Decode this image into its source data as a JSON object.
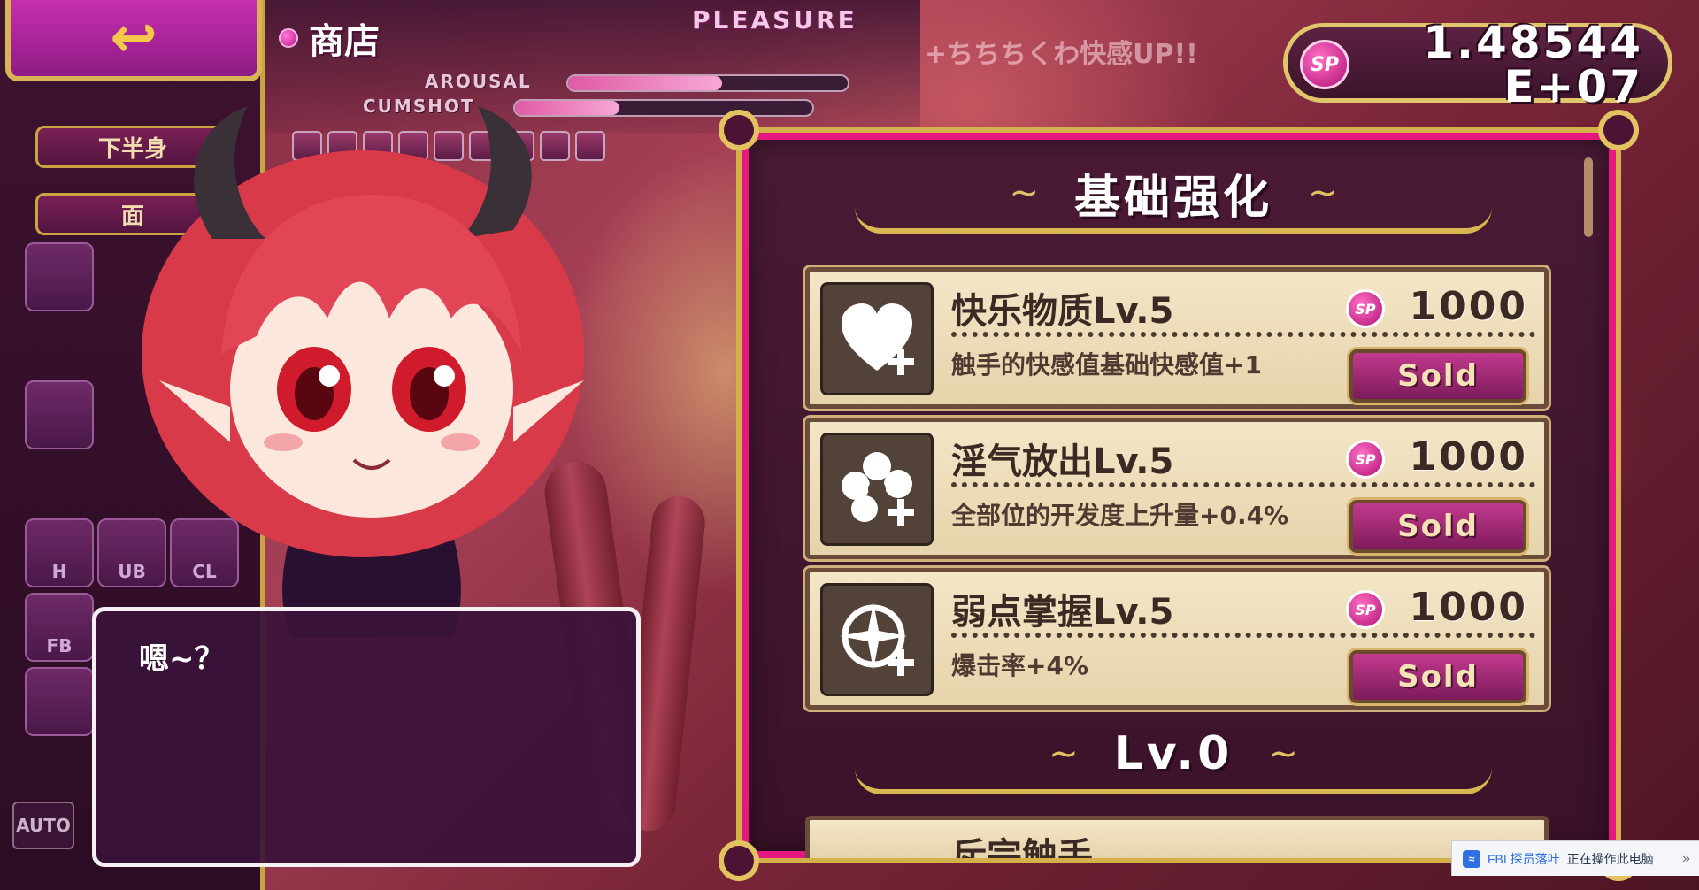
{
  "top_bar": {
    "shop_title": "商店",
    "pleasure_label": "PLEASURE",
    "arousal_label": "AROUSAL",
    "cumshot_label": "CUMSHOT",
    "arousal_level": 0.55,
    "cumshot_level": 0.35,
    "faint_info": "+ちちちくわ快感UP!!"
  },
  "sp": {
    "coin_label": "SP",
    "value_line1": "1.48544",
    "value_line2": "E+07"
  },
  "left_menu": {
    "tabs": [
      "下半身",
      "面"
    ],
    "icons": [
      "H",
      "UB",
      "CL",
      "FB"
    ],
    "auto_label": "AUTO"
  },
  "shop": {
    "section_title": "基础强化",
    "next_section_title": "Lv.0",
    "items": [
      {
        "name": "快乐物质Lv.5",
        "desc": "触手的快感值基础快感值+1",
        "price": "1000",
        "button": "Sold",
        "icon": "heart-plus-icon"
      },
      {
        "name": "淫气放出Lv.5",
        "desc": "全部位的开发度上升量+0.4%",
        "price": "1000",
        "button": "Sold",
        "icon": "burst-plus-icon"
      },
      {
        "name": "弱点掌握Lv.5",
        "desc": "爆击率+4%",
        "price": "1000",
        "button": "Sold",
        "icon": "crosshair-plus-icon"
      }
    ],
    "partial_item_name": "斥完触手",
    "coin_label": "SP"
  },
  "dialog": {
    "text": "嗯~？"
  },
  "system_notification": {
    "icon_label": "≈",
    "app_name": "FBI 探员落叶",
    "message": "正在操作此电脑",
    "chevron": "»"
  },
  "colors": {
    "panel_border": "#e6177e",
    "gold": "#d4b04a",
    "card_bg": "#f3e6c7",
    "sold_button": "#c33a8d"
  }
}
